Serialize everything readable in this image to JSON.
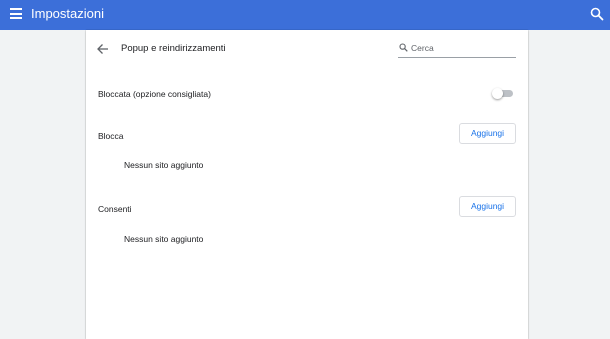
{
  "header": {
    "title": "Impostazioni",
    "menu_icon": "hamburger-menu-icon",
    "search_icon": "search-icon",
    "bar_color": "#3c6fd9"
  },
  "subpage": {
    "title": "Popup e reindirizzamenti",
    "back_icon": "arrow-back-icon",
    "search": {
      "placeholder": "Cerca",
      "value": ""
    }
  },
  "toggle_row": {
    "label": "Bloccata (opzione consigliata)",
    "state": "off"
  },
  "sections": {
    "block": {
      "title": "Blocca",
      "button_label": "Aggiungi",
      "empty_text": "Nessun sito aggiunto"
    },
    "allow": {
      "title": "Consenti",
      "button_label": "Aggiungi",
      "empty_text": "Nessun sito aggiunto"
    }
  },
  "colors": {
    "accent": "#1a73e8",
    "background": "#f1f3f4",
    "card": "#ffffff"
  }
}
